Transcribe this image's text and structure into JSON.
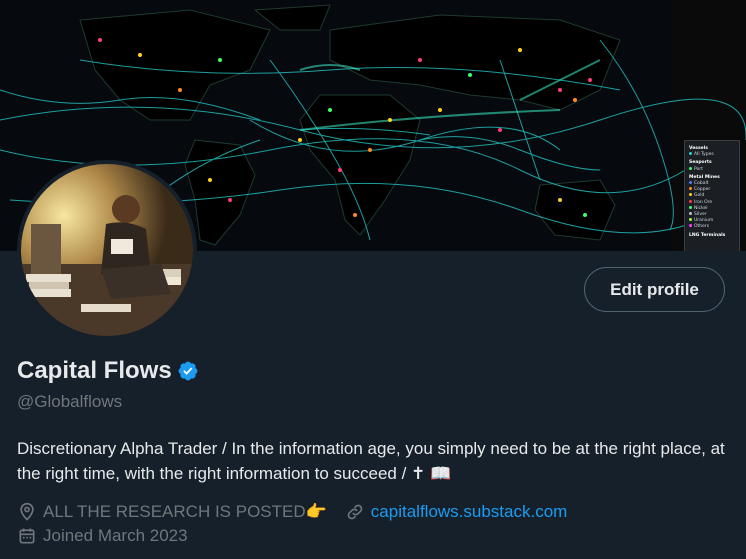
{
  "banner": {
    "legend": {
      "heading1": "Vessels",
      "item0": "All Types",
      "heading2": "Seaports",
      "item1": "Port",
      "heading3": "Metal Mines",
      "metals": [
        "Cobalt",
        "Copper",
        "Gold",
        "Iron Ore",
        "Nickel",
        "Silver",
        "Uranium",
        "Others"
      ],
      "heading4": "LNG Terminals"
    }
  },
  "profile": {
    "display_name": "Capital Flows",
    "handle": "@Globalflows",
    "edit_label": "Edit profile",
    "bio": "Discretionary Alpha Trader / In the information age, you simply need to be at the right place, at the right time, with the right information to succeed / ✝ 📖",
    "location": "ALL THE RESEARCH IS POSTED👉",
    "website": "capitalflows.substack.com",
    "joined": "Joined March 2023"
  },
  "colors": {
    "background": "#15202b",
    "link": "#1d9bf0",
    "verified": "#1d9bf0",
    "muted": "#71767b",
    "text": "#e7e9ea"
  },
  "icons": {
    "verified": "verified-badge-icon",
    "location": "location-pin-icon",
    "link": "link-icon",
    "calendar": "calendar-icon"
  }
}
